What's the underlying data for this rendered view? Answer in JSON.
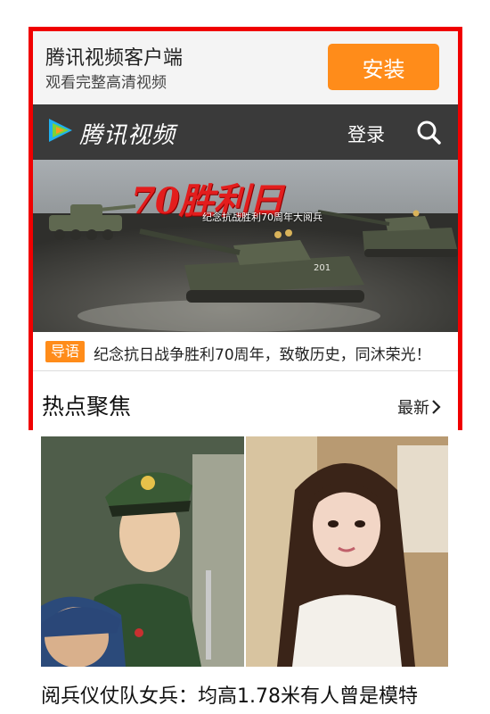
{
  "promo": {
    "app_name": "腾讯视频客户端",
    "tagline": "观看完整高清视频",
    "install_label": "安装"
  },
  "header": {
    "logo_text": "腾讯视频",
    "login_label": "登录",
    "search_icon": "search-icon"
  },
  "banner": {
    "title": "70胜利日",
    "subtitle": "纪念抗战胜利70周年大阅兵",
    "tank_number": "201"
  },
  "caption": {
    "tag": "导语",
    "text": "纪念抗日战争胜利70周年，致敬历史，同沐荣光！"
  },
  "section": {
    "title": "热点聚焦",
    "more_label": "最新"
  },
  "feature": {
    "headline": "阅兵仪仗队女兵：均高1.78米有人曾是模特"
  },
  "colors": {
    "accent": "#ff8c1a",
    "frame": "#f00000",
    "topbar": "#3a3a3a"
  }
}
